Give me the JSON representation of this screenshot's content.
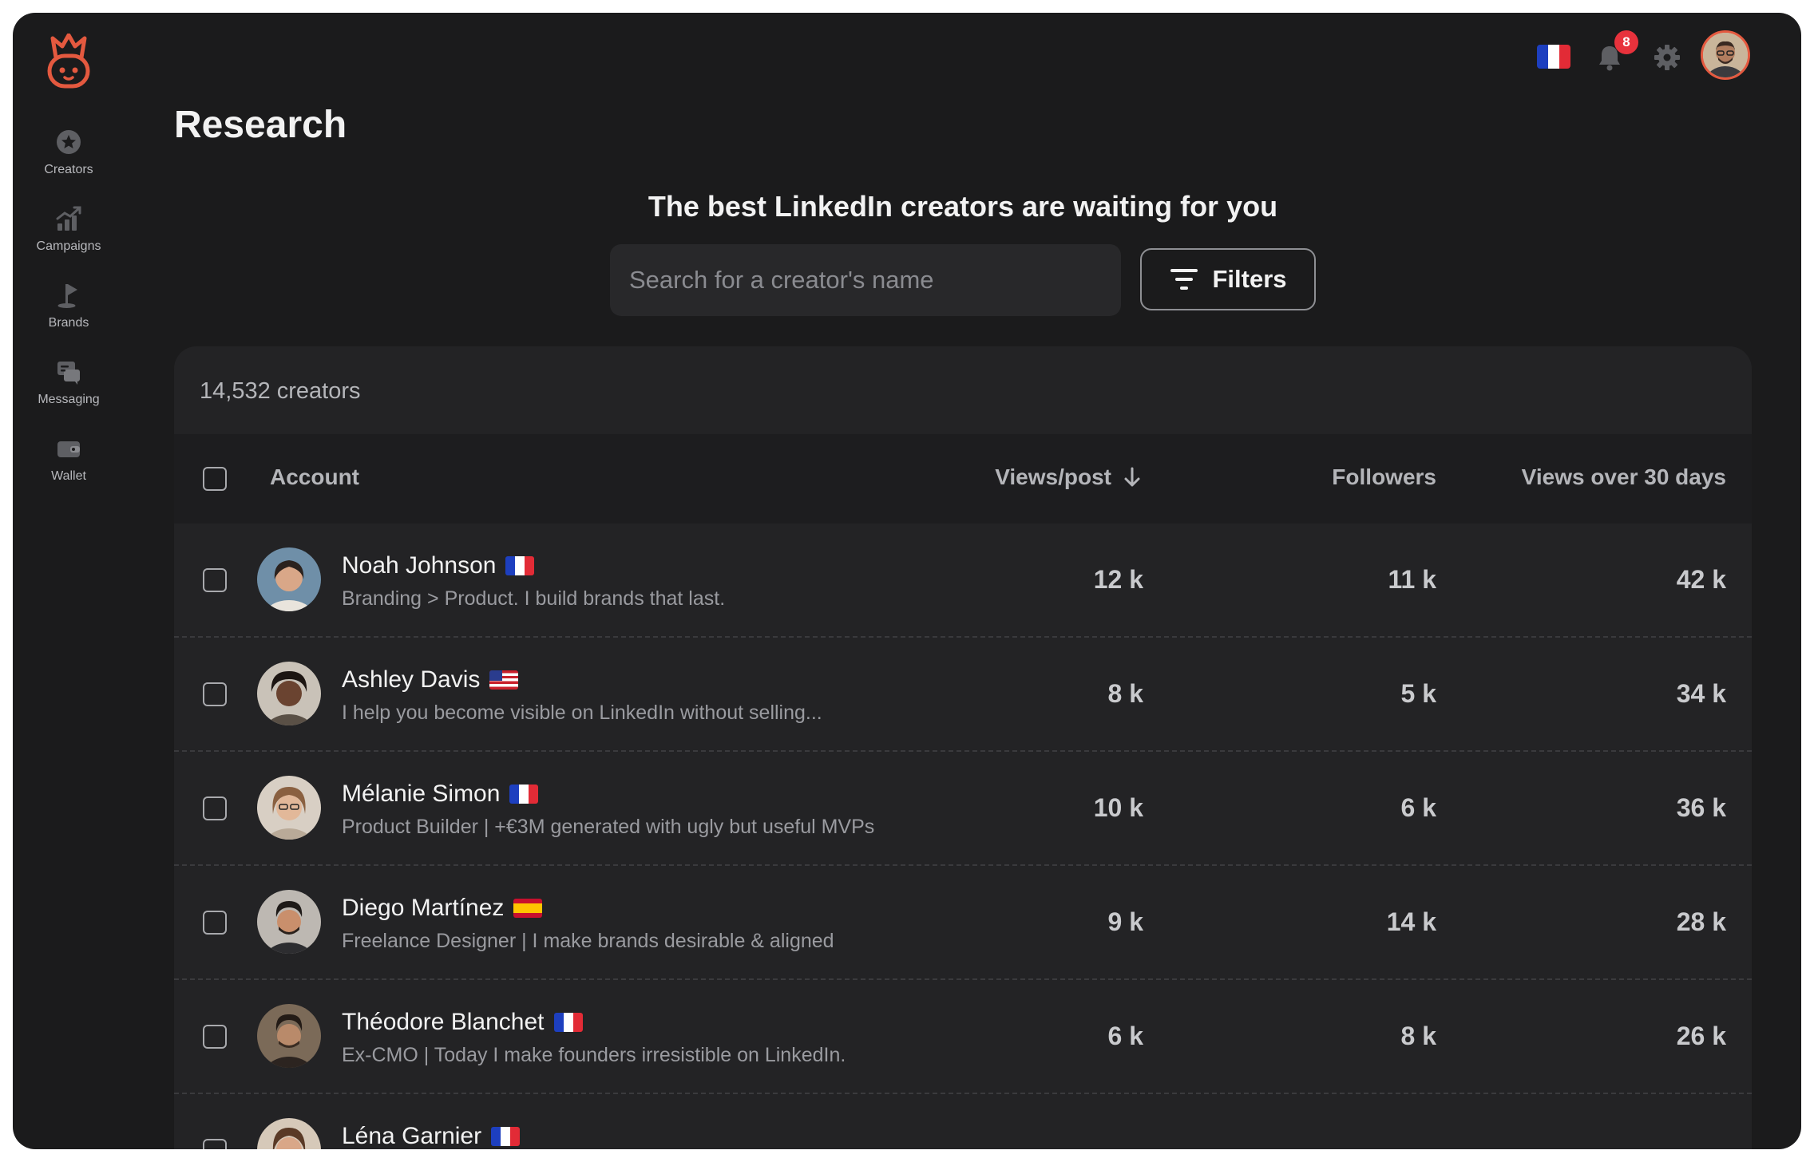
{
  "app": {
    "brand_color": "#e4593f",
    "page_title": "Research"
  },
  "sidebar": {
    "items": [
      {
        "label": "Creators",
        "icon": "star-icon"
      },
      {
        "label": "Campaigns",
        "icon": "chart-up-icon"
      },
      {
        "label": "Brands",
        "icon": "flag-icon"
      },
      {
        "label": "Messaging",
        "icon": "chat-icon"
      },
      {
        "label": "Wallet",
        "icon": "wallet-icon"
      }
    ]
  },
  "topbar": {
    "language": "fr",
    "notifications": "8"
  },
  "hero": {
    "heading": "The best LinkedIn creators are waiting for you",
    "search_placeholder": "Search for a creator's name",
    "filters_label": "Filters"
  },
  "table": {
    "count": "14,532 creators",
    "columns": {
      "account": "Account",
      "views_post": "Views/post",
      "followers": "Followers",
      "views_30": "Views over 30 days"
    },
    "rows": [
      {
        "name": "Noah Johnson",
        "flag": "fr",
        "bio": "Branding > Product. I build brands that last.",
        "views_post": "12 k",
        "followers": "11 k",
        "views_30": "42 k"
      },
      {
        "name": "Ashley Davis",
        "flag": "us",
        "bio": "I help you become visible on LinkedIn without selling...",
        "views_post": "8 k",
        "followers": "5 k",
        "views_30": "34 k"
      },
      {
        "name": "Mélanie Simon",
        "flag": "fr",
        "bio": "Product Builder | +€3M generated with ugly but useful MVPs",
        "views_post": "10 k",
        "followers": "6 k",
        "views_30": "36 k"
      },
      {
        "name": "Diego Martínez",
        "flag": "es",
        "bio": "Freelance Designer | I make brands desirable & aligned",
        "views_post": "9 k",
        "followers": "14 k",
        "views_30": "28 k"
      },
      {
        "name": "Théodore Blanchet",
        "flag": "fr",
        "bio": "Ex-CMO | Today I make founders irresistible on LinkedIn.",
        "views_post": "6 k",
        "followers": "8 k",
        "views_30": "26 k"
      },
      {
        "name": "Léna Garnier",
        "flag": "fr",
        "bio": "",
        "views_post": "",
        "followers": "",
        "views_30": ""
      }
    ]
  }
}
